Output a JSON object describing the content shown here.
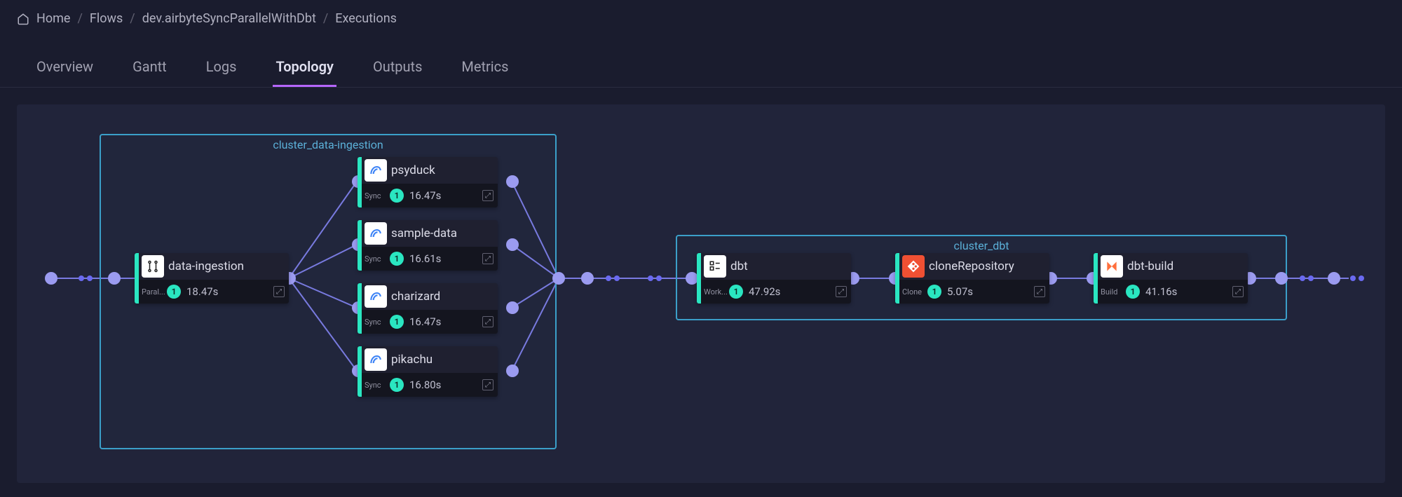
{
  "breadcrumb": {
    "home": "Home",
    "flows": "Flows",
    "flow": "dev.airbyteSyncParallelWithDbt",
    "executions": "Executions"
  },
  "tabs": {
    "overview": "Overview",
    "gantt": "Gantt",
    "logs": "Logs",
    "topology": "Topology",
    "outputs": "Outputs",
    "metrics": "Metrics"
  },
  "clusters": {
    "ingestion": {
      "label": "cluster_data-ingestion"
    },
    "dbt": {
      "label": "cluster_dbt"
    }
  },
  "nodes": {
    "data_ingestion": {
      "title": "data-ingestion",
      "type": "Paral...",
      "badge": "1",
      "duration": "18.47s"
    },
    "psyduck": {
      "title": "psyduck",
      "type": "Sync",
      "badge": "1",
      "duration": "16.47s"
    },
    "sample_data": {
      "title": "sample-data",
      "type": "Sync",
      "badge": "1",
      "duration": "16.61s"
    },
    "charizard": {
      "title": "charizard",
      "type": "Sync",
      "badge": "1",
      "duration": "16.47s"
    },
    "pikachu": {
      "title": "pikachu",
      "type": "Sync",
      "badge": "1",
      "duration": "16.80s"
    },
    "dbt": {
      "title": "dbt",
      "type": "Work...",
      "badge": "1",
      "duration": "47.92s"
    },
    "clone_repo": {
      "title": "cloneRepository",
      "type": "Clone",
      "badge": "1",
      "duration": "5.07s"
    },
    "dbt_build": {
      "title": "dbt-build",
      "type": "Build",
      "badge": "1",
      "duration": "41.16s"
    }
  }
}
